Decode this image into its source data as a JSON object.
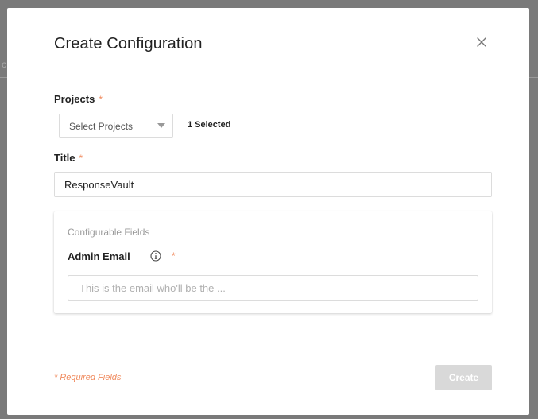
{
  "backdrop": {
    "partial_char": "c"
  },
  "modal": {
    "title": "Create Configuration",
    "close_icon": "close-icon"
  },
  "projects": {
    "label": "Projects",
    "required_marker": "*",
    "select_placeholder": "Select Projects",
    "caret_icon": "caret-down-icon",
    "selected_count": "1 Selected"
  },
  "title_field": {
    "label": "Title",
    "required_marker": "*",
    "value": "ResponseVault"
  },
  "configurable_fields": {
    "heading": "Configurable Fields",
    "admin_email": {
      "label": "Admin Email",
      "info_icon": "info-icon",
      "required_marker": "*",
      "placeholder": "This is the email who'll be the ...",
      "value": ""
    }
  },
  "footer": {
    "required_note": "* Required Fields",
    "create_label": "Create"
  },
  "colors": {
    "accent_orange": "#f08a5d",
    "disabled_button": "#d9d9d9",
    "overlay": "#7a7a7a"
  }
}
